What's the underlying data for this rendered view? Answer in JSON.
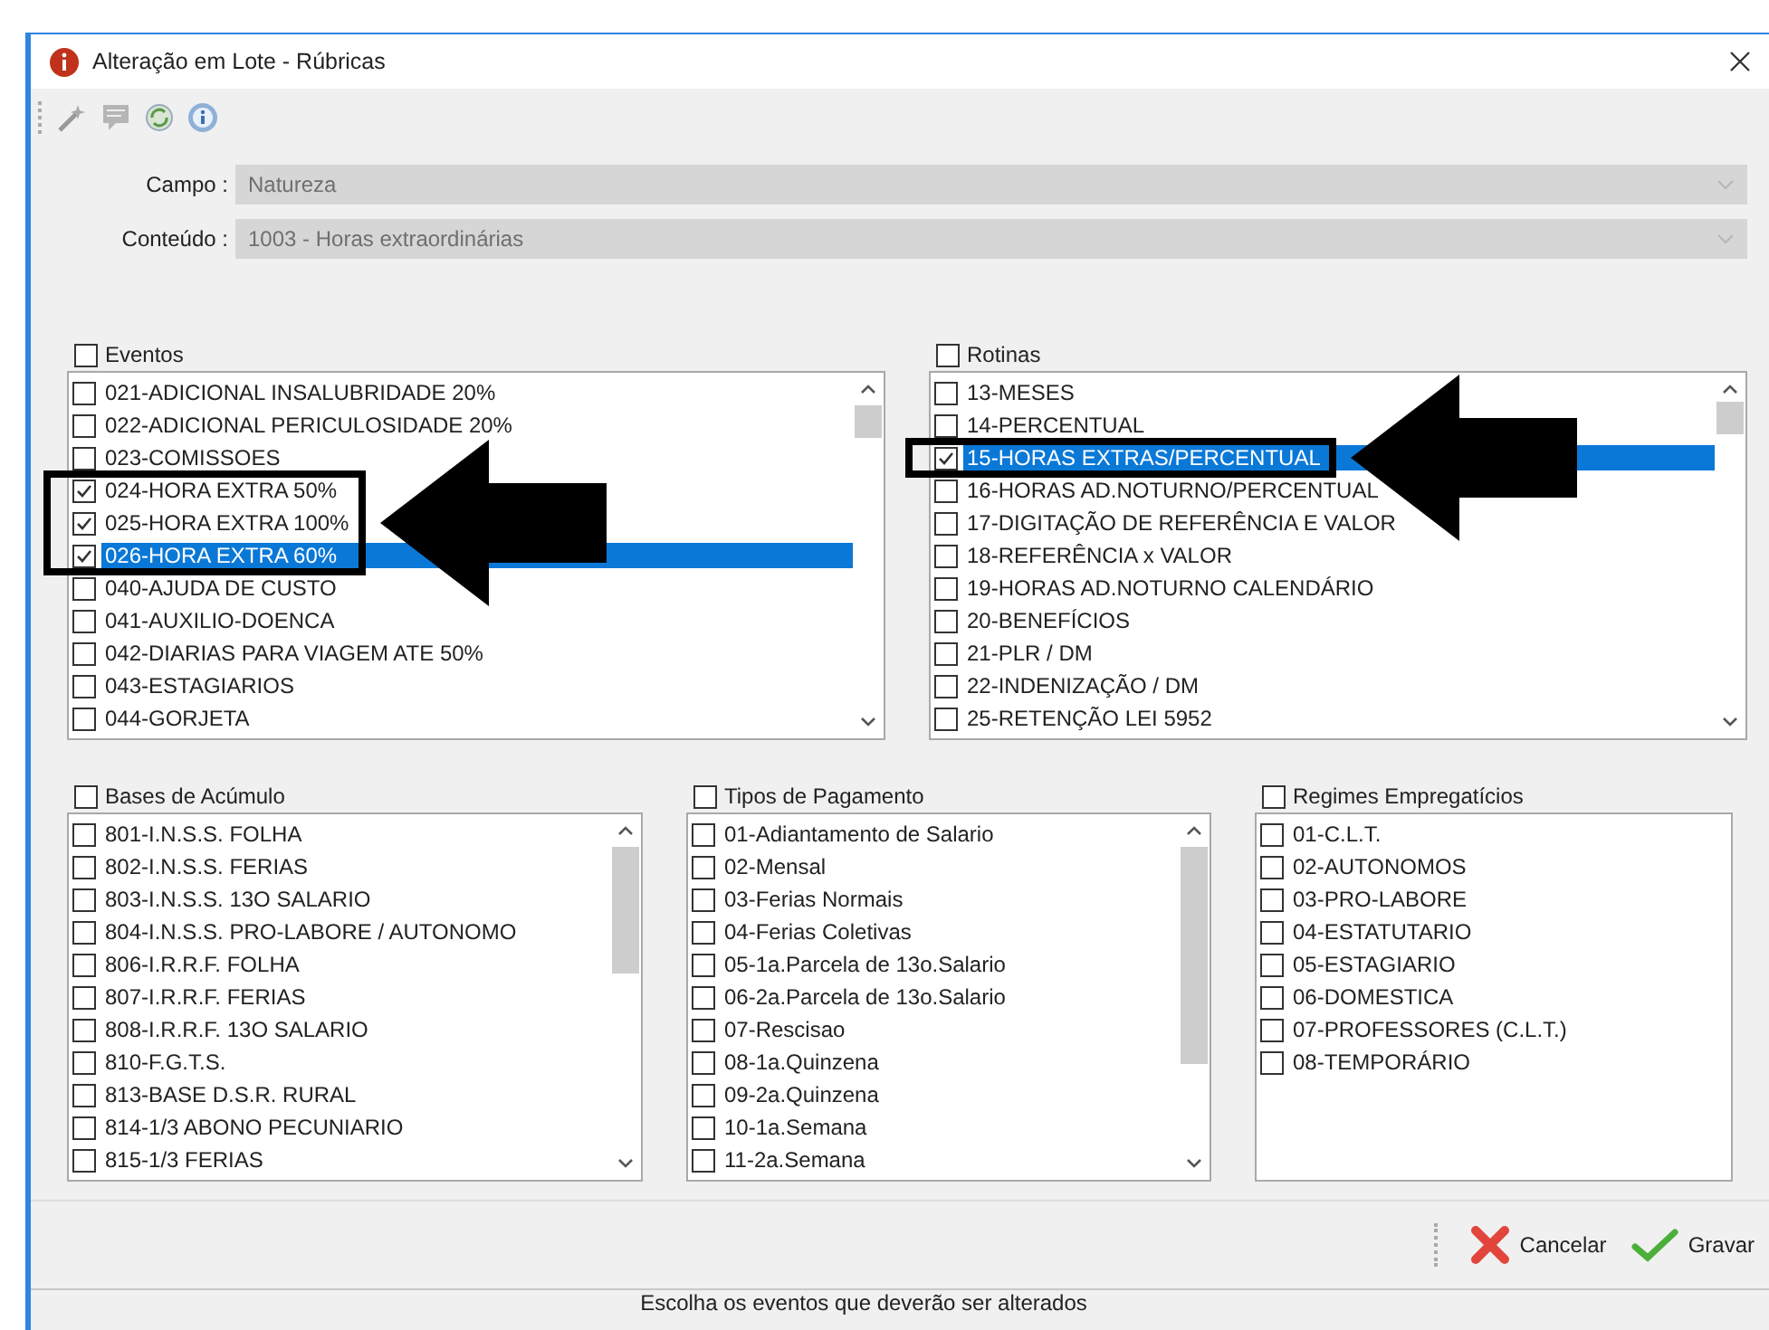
{
  "window": {
    "title": "Alteração em Lote - Rúbricas"
  },
  "fields": [
    {
      "label": "Campo :",
      "value": "Natureza",
      "disabled": true
    },
    {
      "label": "Conteúdo :",
      "value": "1003 - Horas extraordinárias",
      "disabled": true
    }
  ],
  "groups": [
    {
      "title": "Eventos",
      "checked": false,
      "scrollbar": true,
      "items": [
        {
          "label": "021-ADICIONAL INSALUBRIDADE 20%",
          "checked": false,
          "selected": false,
          "marked": false
        },
        {
          "label": "022-ADICIONAL PERICULOSIDADE 20%",
          "checked": false,
          "selected": false,
          "marked": false
        },
        {
          "label": "023-COMISSOES",
          "checked": false,
          "selected": false,
          "marked": false
        },
        {
          "label": "024-HORA EXTRA 50%",
          "checked": true,
          "selected": false,
          "marked": true
        },
        {
          "label": "025-HORA EXTRA 100%",
          "checked": true,
          "selected": false,
          "marked": true
        },
        {
          "label": "026-HORA EXTRA 60%",
          "checked": true,
          "selected": true,
          "marked": true
        },
        {
          "label": "040-AJUDA DE CUSTO",
          "checked": false,
          "selected": false,
          "marked": false
        },
        {
          "label": "041-AUXILIO-DOENCA",
          "checked": false,
          "selected": false,
          "marked": false
        },
        {
          "label": "042-DIARIAS PARA VIAGEM ATE 50%",
          "checked": false,
          "selected": false,
          "marked": false
        },
        {
          "label": "043-ESTAGIARIOS",
          "checked": false,
          "selected": false,
          "marked": false
        },
        {
          "label": "044-GORJETA",
          "checked": false,
          "selected": false,
          "marked": false
        }
      ]
    },
    {
      "title": "Rotinas",
      "checked": false,
      "scrollbar": true,
      "items": [
        {
          "label": "13-MESES",
          "checked": false,
          "selected": false,
          "marked": false
        },
        {
          "label": "14-PERCENTUAL",
          "checked": false,
          "selected": false,
          "marked": false
        },
        {
          "label": "15-HORAS EXTRAS/PERCENTUAL",
          "checked": true,
          "selected": true,
          "marked": true
        },
        {
          "label": "16-HORAS AD.NOTURNO/PERCENTUAL",
          "checked": false,
          "selected": false,
          "marked": false
        },
        {
          "label": "17-DIGITAÇÃO DE REFERÊNCIA E VALOR",
          "checked": false,
          "selected": false,
          "marked": false
        },
        {
          "label": "18-REFERÊNCIA x VALOR",
          "checked": false,
          "selected": false,
          "marked": false
        },
        {
          "label": "19-HORAS AD.NOTURNO CALENDÁRIO",
          "checked": false,
          "selected": false,
          "marked": false
        },
        {
          "label": "20-BENEFÍCIOS",
          "checked": false,
          "selected": false,
          "marked": false
        },
        {
          "label": "21-PLR / DM",
          "checked": false,
          "selected": false,
          "marked": false
        },
        {
          "label": "22-INDENIZAÇÃO / DM",
          "checked": false,
          "selected": false,
          "marked": false
        },
        {
          "label": "25-RETENÇÃO LEI 5952",
          "checked": false,
          "selected": false,
          "marked": false
        }
      ]
    },
    {
      "title": "Bases de Acúmulo",
      "checked": false,
      "scrollbar": true,
      "items": [
        {
          "label": "801-I.N.S.S. FOLHA",
          "checked": false,
          "selected": false,
          "marked": false
        },
        {
          "label": "802-I.N.S.S. FERIAS",
          "checked": false,
          "selected": false,
          "marked": false
        },
        {
          "label": "803-I.N.S.S. 13O SALARIO",
          "checked": false,
          "selected": false,
          "marked": false
        },
        {
          "label": "804-I.N.S.S. PRO-LABORE / AUTONOMO",
          "checked": false,
          "selected": false,
          "marked": false
        },
        {
          "label": "806-I.R.R.F. FOLHA",
          "checked": false,
          "selected": false,
          "marked": false
        },
        {
          "label": "807-I.R.R.F. FERIAS",
          "checked": false,
          "selected": false,
          "marked": false
        },
        {
          "label": "808-I.R.R.F. 13O SALARIO",
          "checked": false,
          "selected": false,
          "marked": false
        },
        {
          "label": "810-F.G.T.S.",
          "checked": false,
          "selected": false,
          "marked": false
        },
        {
          "label": "813-BASE D.S.R. RURAL",
          "checked": false,
          "selected": false,
          "marked": false
        },
        {
          "label": "814-1/3 ABONO PECUNIARIO",
          "checked": false,
          "selected": false,
          "marked": false
        },
        {
          "label": "815-1/3 FERIAS",
          "checked": false,
          "selected": false,
          "marked": false
        }
      ]
    },
    {
      "title": "Tipos de Pagamento",
      "checked": false,
      "scrollbar": true,
      "items": [
        {
          "label": "01-Adiantamento de Salario",
          "checked": false,
          "selected": false,
          "marked": false
        },
        {
          "label": "02-Mensal",
          "checked": false,
          "selected": false,
          "marked": false
        },
        {
          "label": "03-Ferias Normais",
          "checked": false,
          "selected": false,
          "marked": false
        },
        {
          "label": "04-Ferias Coletivas",
          "checked": false,
          "selected": false,
          "marked": false
        },
        {
          "label": "05-1a.Parcela de 13o.Salario",
          "checked": false,
          "selected": false,
          "marked": false
        },
        {
          "label": "06-2a.Parcela de 13o.Salario",
          "checked": false,
          "selected": false,
          "marked": false
        },
        {
          "label": "07-Rescisao",
          "checked": false,
          "selected": false,
          "marked": false
        },
        {
          "label": "08-1a.Quinzena",
          "checked": false,
          "selected": false,
          "marked": false
        },
        {
          "label": "09-2a.Quinzena",
          "checked": false,
          "selected": false,
          "marked": false
        },
        {
          "label": "10-1a.Semana",
          "checked": false,
          "selected": false,
          "marked": false
        },
        {
          "label": "11-2a.Semana",
          "checked": false,
          "selected": false,
          "marked": false
        }
      ]
    },
    {
      "title": "Regimes Empregatícios",
      "checked": false,
      "scrollbar": false,
      "items": [
        {
          "label": "01-C.L.T.",
          "checked": false,
          "selected": false,
          "marked": false
        },
        {
          "label": "02-AUTONOMOS",
          "checked": false,
          "selected": false,
          "marked": false
        },
        {
          "label": "03-PRO-LABORE",
          "checked": false,
          "selected": false,
          "marked": false
        },
        {
          "label": "04-ESTATUTARIO",
          "checked": false,
          "selected": false,
          "marked": false
        },
        {
          "label": "05-ESTAGIARIO",
          "checked": false,
          "selected": false,
          "marked": false
        },
        {
          "label": "06-DOMESTICA",
          "checked": false,
          "selected": false,
          "marked": false
        },
        {
          "label": "07-PROFESSORES (C.L.T.)",
          "checked": false,
          "selected": false,
          "marked": false
        },
        {
          "label": "08-TEMPORÁRIO",
          "checked": false,
          "selected": false,
          "marked": false
        }
      ]
    }
  ],
  "buttons": [
    {
      "label": "Cancelar",
      "kind": "cancel"
    },
    {
      "label": "Gravar",
      "kind": "save"
    }
  ],
  "status_bar": "Escolha os eventos que deverão ser alterados"
}
